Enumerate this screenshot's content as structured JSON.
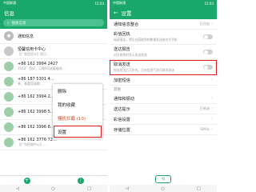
{
  "left": {
    "status": {
      "carrier": "中国联通",
      "time": "15:03"
    },
    "title": "信息",
    "search_placeholder": "搜索信息",
    "rows": [
      {
        "title": "通知信息",
        "sub": "",
        "avatar": "bell"
      },
      {
        "title": "恒馨信用卡中心",
        "sub": "【广发信用卡】您已…",
        "avatar": "grey"
      },
      {
        "title": "+86 162 3994 2427",
        "sub": "1010：您好，订购4G流量服务…",
        "avatar": "green"
      },
      {
        "title": "+86 187 5301 4…",
        "sub": "亲，恭喜您获取…",
        "avatar": "green"
      },
      {
        "title": "+86 162 3994 2…",
        "sub": "",
        "avatar": "green"
      },
      {
        "title": "+86 162 3998 5…",
        "sub": "",
        "avatar": "green"
      },
      {
        "title": "+86 162 3996 8…",
        "sub": "",
        "avatar": "green"
      },
      {
        "title": "+86 162 3776 72…",
        "sub": "【广东招商中心】…",
        "avatar": "green"
      }
    ],
    "menu": [
      {
        "label": "删除",
        "style": ""
      },
      {
        "label": "我的收藏",
        "style": ""
      },
      {
        "label": "骚扰拦截 (10)",
        "style": "red"
      },
      {
        "label": "设置",
        "style": "hl"
      }
    ],
    "bottom": {
      "icon_left": "compose-icon",
      "icon_right": "more-icon"
    },
    "navbar": [
      "◁",
      "○",
      "□"
    ]
  },
  "right": {
    "status": {
      "carrier": "中国联通",
      "time": "15:03"
    },
    "back": "←",
    "title": "设置",
    "rows": [
      {
        "type": "value",
        "title": "通知信息整合",
        "value": "已开启"
      },
      {
        "type": "toggle",
        "title": "彩信回执",
        "sub": "阅读报告，将后台获取到的数据发送给对方手机"
      },
      {
        "type": "toggle",
        "title": "送达报告",
        "sub": "对方收到时显示发送状态"
      },
      {
        "type": "toggle",
        "title": "取消发送",
        "sub": "短信发出后几秒内，点击信息气泡可取消发送",
        "highlight": true
      },
      {
        "type": "arrow",
        "title": "加密短信"
      },
      {
        "type": "header",
        "title": "其他"
      },
      {
        "type": "arrow",
        "title": "通知和振动"
      },
      {
        "type": "arrow",
        "title": "送达提示",
        "value": "已关闭"
      },
      {
        "type": "value",
        "title": "彩信设置",
        "value": ""
      },
      {
        "type": "arrow",
        "title": "存储位置",
        "value": "SIM卡"
      }
    ],
    "restore": "恢复",
    "navbar": [
      "◁",
      "○",
      "□"
    ]
  }
}
